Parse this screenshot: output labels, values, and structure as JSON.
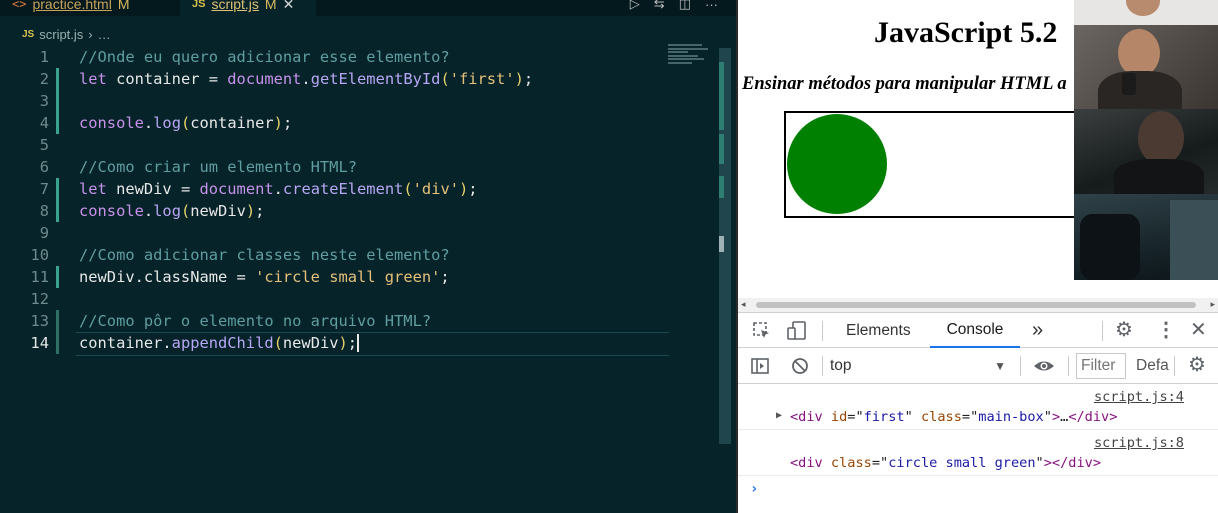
{
  "editor": {
    "tabs": [
      {
        "name": "practice.html",
        "status": "M",
        "icon": "html-file-icon"
      },
      {
        "name": "script.js",
        "status": "M",
        "icon": "js-file-icon",
        "active": true
      }
    ],
    "breadcrumb": {
      "file": "script.js",
      "more": "…"
    },
    "lines": [
      {
        "n": "1",
        "tokens": [
          [
            "com",
            "//Onde eu quero adicionar esse elemento?"
          ]
        ]
      },
      {
        "n": "2",
        "tokens": [
          [
            "kw",
            "let"
          ],
          [
            "pl",
            " container = "
          ],
          [
            "kw",
            "document"
          ],
          [
            "pl",
            "."
          ],
          [
            "fn",
            "getElementById"
          ],
          [
            "par",
            "("
          ],
          [
            "str",
            "'first'"
          ],
          [
            "par",
            ")"
          ],
          [
            "pl",
            ";"
          ]
        ]
      },
      {
        "n": "3",
        "tokens": []
      },
      {
        "n": "4",
        "tokens": [
          [
            "kw",
            "console"
          ],
          [
            "pl",
            "."
          ],
          [
            "fn",
            "log"
          ],
          [
            "par",
            "("
          ],
          [
            "pl",
            "container"
          ],
          [
            "par",
            ")"
          ],
          [
            "pl",
            ";"
          ]
        ]
      },
      {
        "n": "5",
        "tokens": []
      },
      {
        "n": "6",
        "tokens": [
          [
            "com",
            "//Como criar um elemento HTML?"
          ]
        ]
      },
      {
        "n": "7",
        "tokens": [
          [
            "kw",
            "let"
          ],
          [
            "pl",
            " newDiv = "
          ],
          [
            "kw",
            "document"
          ],
          [
            "pl",
            "."
          ],
          [
            "fn",
            "createElement"
          ],
          [
            "par",
            "("
          ],
          [
            "str",
            "'div'"
          ],
          [
            "par",
            ")"
          ],
          [
            "pl",
            ";"
          ]
        ]
      },
      {
        "n": "8",
        "tokens": [
          [
            "kw",
            "console"
          ],
          [
            "pl",
            "."
          ],
          [
            "fn",
            "log"
          ],
          [
            "par",
            "("
          ],
          [
            "pl",
            "newDiv"
          ],
          [
            "par",
            ")"
          ],
          [
            "pl",
            ";"
          ]
        ]
      },
      {
        "n": "9",
        "tokens": []
      },
      {
        "n": "10",
        "tokens": [
          [
            "com",
            "//Como adicionar classes neste elemento?"
          ]
        ]
      },
      {
        "n": "11",
        "tokens": [
          [
            "pl",
            "newDiv.className = "
          ],
          [
            "str",
            "'circle small green'"
          ],
          [
            "pl",
            ";"
          ]
        ]
      },
      {
        "n": "12",
        "tokens": []
      },
      {
        "n": "13",
        "tokens": [
          [
            "com",
            "//Como pôr o elemento no arquivo HTML?"
          ]
        ]
      },
      {
        "n": "14",
        "tokens": [
          [
            "pl",
            "container."
          ],
          [
            "fn",
            "appendChild"
          ],
          [
            "par",
            "("
          ],
          [
            "pl",
            "newDiv"
          ],
          [
            "par",
            ")"
          ],
          [
            "pl",
            ";"
          ]
        ],
        "current": true
      }
    ]
  },
  "preview": {
    "title": "JavaScript 5.2",
    "subtitle": "Ensinar métodos para manipular HTML a",
    "circle_color": "#008000"
  },
  "devtools": {
    "tabs": [
      "Elements",
      "Console"
    ],
    "active_tab": "Console",
    "more_tabs": "»",
    "context": "top",
    "filter_placeholder": "Filter",
    "levels_label": "Defa",
    "messages": [
      {
        "source": "script.js:4",
        "expandable": true,
        "html": [
          [
            "tag",
            "<div "
          ],
          [
            "attr",
            "id"
          ],
          [
            "pl",
            "=\""
          ],
          [
            "val",
            "first"
          ],
          [
            "pl",
            "\" "
          ],
          [
            "attr",
            "class"
          ],
          [
            "pl",
            "=\""
          ],
          [
            "val",
            "main-box"
          ],
          [
            "pl",
            "\""
          ],
          [
            "tag",
            ">"
          ],
          [
            "pl",
            "…"
          ],
          [
            "tag",
            "</div>"
          ]
        ]
      },
      {
        "source": "script.js:8",
        "expandable": false,
        "html": [
          [
            "tag",
            "<div "
          ],
          [
            "attr",
            "class"
          ],
          [
            "pl",
            "=\""
          ],
          [
            "val",
            "circle small green"
          ],
          [
            "pl",
            "\""
          ],
          [
            "tag",
            ">"
          ],
          [
            "tag",
            "</div>"
          ]
        ]
      }
    ],
    "prompt": "›"
  }
}
